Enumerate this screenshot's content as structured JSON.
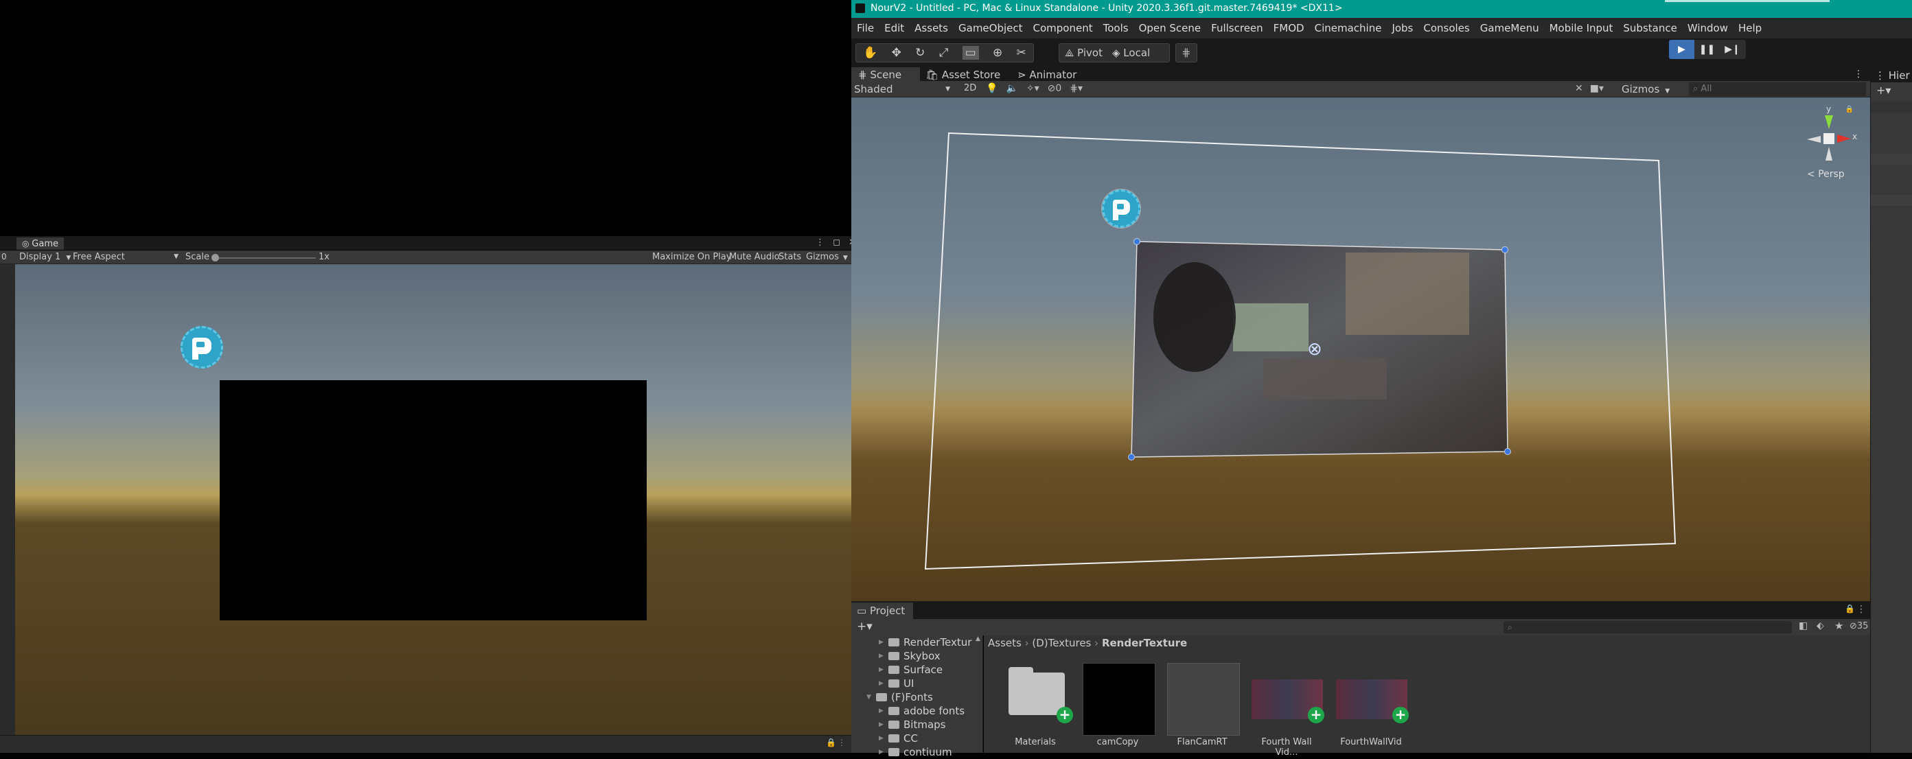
{
  "game": {
    "tab_label": "Game",
    "display": "Display 1",
    "aspect": "Free Aspect",
    "scale_label": "Scale",
    "scale_value": "1x",
    "maximize_on_play": "Maximize On Play",
    "mute_audio": "Mute Audio",
    "stats": "Stats",
    "gizmos": "Gizmos",
    "left_counter": "0"
  },
  "editor": {
    "title": "NourV2 - Untitled - PC, Mac & Linux Standalone - Unity 2020.3.36f1.git.master.7469419* <DX11>",
    "menu": [
      "File",
      "Edit",
      "Assets",
      "GameObject",
      "Component",
      "Tools",
      "Open Scene",
      "Fullscreen",
      "FMOD",
      "Cinemachine",
      "Jobs",
      "Consoles",
      "GameMenu",
      "Mobile Input",
      "Substance",
      "Window",
      "Help"
    ],
    "pivot": "Pivot",
    "local": "Local"
  },
  "scene": {
    "tabs": [
      "Scene",
      "Asset Store",
      "Animator"
    ],
    "draw_mode": "Shaded",
    "mode_2d": "2D",
    "hidden_count": "0",
    "gizmos": "Gizmos",
    "search_placeholder": "All",
    "persp_label": "Persp",
    "axis_y": "y",
    "axis_x": "x"
  },
  "hierarchy": {
    "tab_label": "Hier"
  },
  "project": {
    "tab_label": "Project",
    "layer_count": "35",
    "breadcrumb": [
      "Assets",
      "(D)Textures",
      "RenderTexture"
    ],
    "tree": [
      {
        "label": "RenderTextur",
        "indent": 1,
        "expanded": false
      },
      {
        "label": "Skybox",
        "indent": 1,
        "expanded": false
      },
      {
        "label": "Surface",
        "indent": 1,
        "expanded": false
      },
      {
        "label": "UI",
        "indent": 1,
        "expanded": false
      },
      {
        "label": "(F)Fonts",
        "indent": 0,
        "expanded": true
      },
      {
        "label": "adobe fonts",
        "indent": 1,
        "expanded": false
      },
      {
        "label": "Bitmaps",
        "indent": 1,
        "expanded": false
      },
      {
        "label": "CC",
        "indent": 1,
        "expanded": false
      },
      {
        "label": "contiuum",
        "indent": 1,
        "expanded": false
      }
    ],
    "assets": [
      "Materials",
      "camCopy",
      "FlanCamRT",
      "Fourth Wall Vid...",
      "FourthWallVid"
    ]
  },
  "colors": {
    "title_bar": "#009a8e",
    "play_accent": "#3d6fb5",
    "badge_green": "#1ea64a"
  }
}
